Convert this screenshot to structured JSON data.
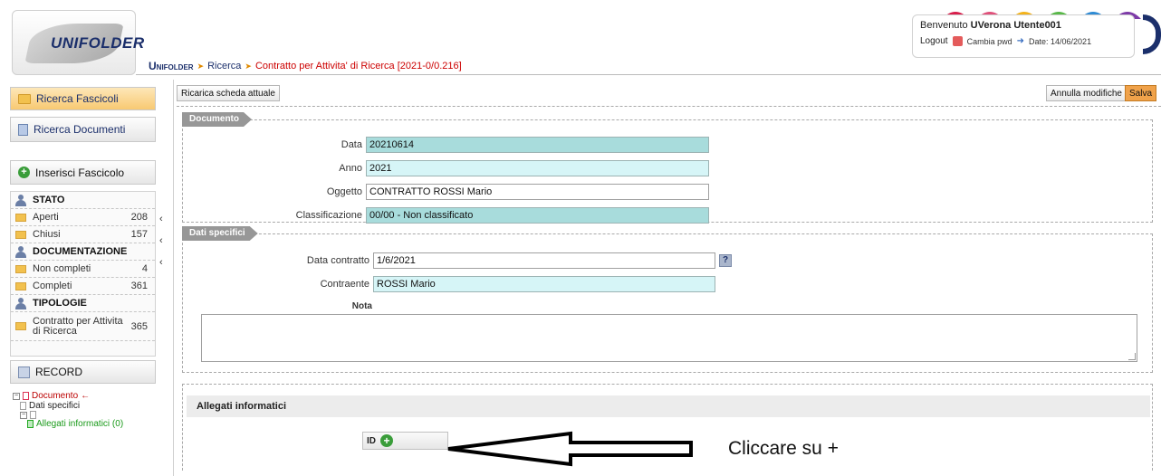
{
  "header": {
    "logo_text": "UNIFOLDER",
    "breadcrumb": {
      "app": "Unifolder",
      "items": [
        "Ricerca",
        "Contratto per Attivita' di Ricerca [2021-0/0.216]"
      ]
    },
    "user": {
      "welcome_prefix": "Benvenuto ",
      "username": "UVerona Utente001",
      "logout_label": "Logout",
      "change_pwd_label": "Cambia pwd",
      "date_label": "Date: 14/06/2021"
    }
  },
  "sidebar": {
    "buttons": {
      "ricerca_fascicoli": "Ricerca Fascicoli",
      "ricerca_documenti": "Ricerca Documenti",
      "inserisci_fascicolo": "Inserisci Fascicolo",
      "record": "RECORD"
    },
    "groups": [
      {
        "title": "STATO",
        "items": [
          {
            "label": "Aperti",
            "count": "208"
          },
          {
            "label": "Chiusi",
            "count": "157"
          }
        ]
      },
      {
        "title": "DOCUMENTAZIONE",
        "items": [
          {
            "label": "Non completi",
            "count": "4"
          },
          {
            "label": "Completi",
            "count": "361"
          }
        ]
      },
      {
        "title": "TIPOLOGIE",
        "items": [
          {
            "label": "Contratto per Attivita di Ricerca",
            "count": "365"
          }
        ]
      }
    ],
    "tree": {
      "documento": "Documento",
      "dati_specifici": "Dati specifici",
      "allegati": "Allegati informatici (0)"
    }
  },
  "toolbar": {
    "reload_label": "Ricarica scheda attuale",
    "cancel_label": "Annulla modifiche",
    "save_label": "Salva"
  },
  "documento": {
    "title": "Documento",
    "fields": {
      "data": {
        "label": "Data",
        "value": "20210614"
      },
      "anno": {
        "label": "Anno",
        "value": "2021"
      },
      "oggetto": {
        "label": "Oggetto",
        "value": "CONTRATTO ROSSI Mario"
      },
      "classificazione": {
        "label": "Classificazione",
        "value": "00/00 - Non classificato"
      }
    }
  },
  "dati_specifici": {
    "title": "Dati specifici",
    "fields": {
      "data_contratto": {
        "label": "Data contratto",
        "value": "1/6/2021"
      },
      "contraente": {
        "label": "Contraente",
        "value": "ROSSI Mario"
      },
      "nota": {
        "label": "Nota",
        "value": ""
      }
    },
    "help_label": "?"
  },
  "allegati": {
    "title": "Allegati informatici",
    "id_label": "ID",
    "add_label": "+"
  },
  "annotation": {
    "text": "Cliccare su +"
  },
  "colors": {
    "accent": "#1b2f6b",
    "teal_field": "#a8dcdc",
    "light_teal_field": "#d6f5f7",
    "save": "#f0a24a",
    "breadcrumb_current": "#cc0000"
  }
}
